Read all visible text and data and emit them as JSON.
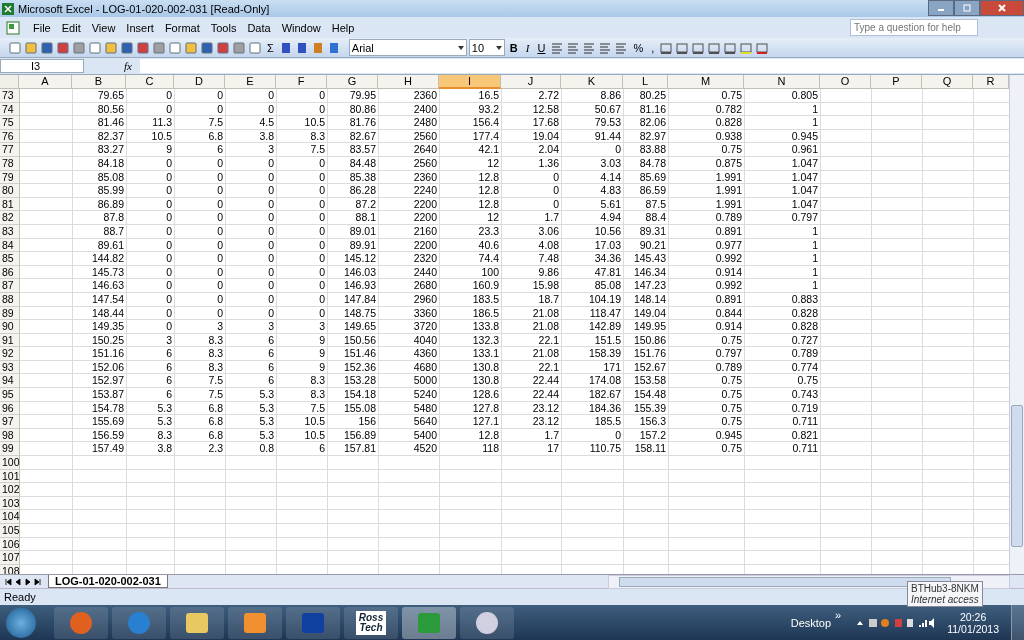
{
  "window": {
    "title": "Microsoft Excel - LOG-01-020-002-031  [Read-Only]"
  },
  "menu": [
    "File",
    "Edit",
    "View",
    "Insert",
    "Format",
    "Tools",
    "Data",
    "Window",
    "Help"
  ],
  "help_box": {
    "placeholder": "Type a question for help"
  },
  "toolbar": {
    "sum": "Σ",
    "font": "Arial",
    "size": "10",
    "format_buttons": [
      "B",
      "I",
      "U"
    ],
    "percent": "%",
    "comma": ","
  },
  "formula_bar": {
    "name_box": "I3",
    "fx": "fx"
  },
  "columns": [
    {
      "label": "A",
      "selected": false
    },
    {
      "label": "B",
      "selected": false
    },
    {
      "label": "C",
      "selected": false
    },
    {
      "label": "D",
      "selected": false
    },
    {
      "label": "E",
      "selected": false
    },
    {
      "label": "F",
      "selected": false
    },
    {
      "label": "G",
      "selected": false
    },
    {
      "label": "H",
      "selected": false
    },
    {
      "label": "I",
      "selected": true
    },
    {
      "label": "J",
      "selected": false
    },
    {
      "label": "K",
      "selected": false
    },
    {
      "label": "L",
      "selected": false
    },
    {
      "label": "M",
      "selected": false
    },
    {
      "label": "N",
      "selected": false
    },
    {
      "label": "O",
      "selected": false
    },
    {
      "label": "P",
      "selected": false
    },
    {
      "label": "Q",
      "selected": false
    },
    {
      "label": "R",
      "selected": false
    }
  ],
  "rows": [
    {
      "num": "73",
      "cells": [
        "79.65",
        "0",
        "0",
        "0",
        "0",
        "79.95",
        "2360",
        "16.5",
        "2.72",
        "8.86",
        "80.25",
        "0.75",
        "0.805"
      ]
    },
    {
      "num": "74",
      "cells": [
        "80.56",
        "0",
        "0",
        "0",
        "0",
        "80.86",
        "2400",
        "93.2",
        "12.58",
        "50.67",
        "81.16",
        "0.782",
        "1"
      ]
    },
    {
      "num": "75",
      "cells": [
        "81.46",
        "11.3",
        "7.5",
        "4.5",
        "10.5",
        "81.76",
        "2480",
        "156.4",
        "17.68",
        "79.53",
        "82.06",
        "0.828",
        "1"
      ]
    },
    {
      "num": "76",
      "cells": [
        "82.37",
        "10.5",
        "6.8",
        "3.8",
        "8.3",
        "82.67",
        "2560",
        "177.4",
        "19.04",
        "91.44",
        "82.97",
        "0.938",
        "0.945"
      ]
    },
    {
      "num": "77",
      "cells": [
        "83.27",
        "9",
        "6",
        "3",
        "7.5",
        "83.57",
        "2640",
        "42.1",
        "2.04",
        "0",
        "83.88",
        "0.75",
        "0.961"
      ]
    },
    {
      "num": "78",
      "cells": [
        "84.18",
        "0",
        "0",
        "0",
        "0",
        "84.48",
        "2560",
        "12",
        "1.36",
        "3.03",
        "84.78",
        "0.875",
        "1.047"
      ]
    },
    {
      "num": "79",
      "cells": [
        "85.08",
        "0",
        "0",
        "0",
        "0",
        "85.38",
        "2360",
        "12.8",
        "0",
        "4.14",
        "85.69",
        "1.991",
        "1.047"
      ]
    },
    {
      "num": "80",
      "cells": [
        "85.99",
        "0",
        "0",
        "0",
        "0",
        "86.28",
        "2240",
        "12.8",
        "0",
        "4.83",
        "86.59",
        "1.991",
        "1.047"
      ]
    },
    {
      "num": "81",
      "cells": [
        "86.89",
        "0",
        "0",
        "0",
        "0",
        "87.2",
        "2200",
        "12.8",
        "0",
        "5.61",
        "87.5",
        "1.991",
        "1.047"
      ]
    },
    {
      "num": "82",
      "cells": [
        "87.8",
        "0",
        "0",
        "0",
        "0",
        "88.1",
        "2200",
        "12",
        "1.7",
        "4.94",
        "88.4",
        "0.789",
        "0.797"
      ]
    },
    {
      "num": "83",
      "cells": [
        "88.7",
        "0",
        "0",
        "0",
        "0",
        "89.01",
        "2160",
        "23.3",
        "3.06",
        "10.56",
        "89.31",
        "0.891",
        "1"
      ]
    },
    {
      "num": "84",
      "cells": [
        "89.61",
        "0",
        "0",
        "0",
        "0",
        "89.91",
        "2200",
        "40.6",
        "4.08",
        "17.03",
        "90.21",
        "0.977",
        "1"
      ]
    },
    {
      "num": "85",
      "cells": [
        "144.82",
        "0",
        "0",
        "0",
        "0",
        "145.12",
        "2320",
        "74.4",
        "7.48",
        "34.36",
        "145.43",
        "0.992",
        "1"
      ]
    },
    {
      "num": "86",
      "cells": [
        "145.73",
        "0",
        "0",
        "0",
        "0",
        "146.03",
        "2440",
        "100",
        "9.86",
        "47.81",
        "146.34",
        "0.914",
        "1"
      ]
    },
    {
      "num": "87",
      "cells": [
        "146.63",
        "0",
        "0",
        "0",
        "0",
        "146.93",
        "2680",
        "160.9",
        "15.98",
        "85.08",
        "147.23",
        "0.992",
        "1"
      ]
    },
    {
      "num": "88",
      "cells": [
        "147.54",
        "0",
        "0",
        "0",
        "0",
        "147.84",
        "2960",
        "183.5",
        "18.7",
        "104.19",
        "148.14",
        "0.891",
        "0.883"
      ]
    },
    {
      "num": "89",
      "cells": [
        "148.44",
        "0",
        "0",
        "0",
        "0",
        "148.75",
        "3360",
        "186.5",
        "21.08",
        "118.47",
        "149.04",
        "0.844",
        "0.828"
      ]
    },
    {
      "num": "90",
      "cells": [
        "149.35",
        "0",
        "3",
        "3",
        "3",
        "149.65",
        "3720",
        "133.8",
        "21.08",
        "142.89",
        "149.95",
        "0.914",
        "0.828"
      ]
    },
    {
      "num": "91",
      "cells": [
        "150.25",
        "3",
        "8.3",
        "6",
        "9",
        "150.56",
        "4040",
        "132.3",
        "22.1",
        "151.5",
        "150.86",
        "0.75",
        "0.727"
      ]
    },
    {
      "num": "92",
      "cells": [
        "151.16",
        "6",
        "8.3",
        "6",
        "9",
        "151.46",
        "4360",
        "133.1",
        "21.08",
        "158.39",
        "151.76",
        "0.797",
        "0.789"
      ]
    },
    {
      "num": "93",
      "cells": [
        "152.06",
        "6",
        "8.3",
        "6",
        "9",
        "152.36",
        "4680",
        "130.8",
        "22.1",
        "171",
        "152.67",
        "0.789",
        "0.774"
      ]
    },
    {
      "num": "94",
      "cells": [
        "152.97",
        "6",
        "7.5",
        "6",
        "8.3",
        "153.28",
        "5000",
        "130.8",
        "22.44",
        "174.08",
        "153.58",
        "0.75",
        "0.75"
      ]
    },
    {
      "num": "95",
      "cells": [
        "153.87",
        "6",
        "7.5",
        "5.3",
        "8.3",
        "154.18",
        "5240",
        "128.6",
        "22.44",
        "182.67",
        "154.48",
        "0.75",
        "0.743"
      ]
    },
    {
      "num": "96",
      "cells": [
        "154.78",
        "5.3",
        "6.8",
        "5.3",
        "7.5",
        "155.08",
        "5480",
        "127.8",
        "23.12",
        "184.36",
        "155.39",
        "0.75",
        "0.719"
      ]
    },
    {
      "num": "97",
      "cells": [
        "155.69",
        "5.3",
        "6.8",
        "5.3",
        "10.5",
        "156",
        "5640",
        "127.1",
        "23.12",
        "185.5",
        "156.3",
        "0.75",
        "0.711"
      ]
    },
    {
      "num": "98",
      "cells": [
        "156.59",
        "8.3",
        "6.8",
        "5.3",
        "10.5",
        "156.89",
        "5400",
        "12.8",
        "1.7",
        "0",
        "157.2",
        "0.945",
        "0.821"
      ]
    },
    {
      "num": "99",
      "cells": [
        "157.49",
        "3.8",
        "2.3",
        "0.8",
        "6",
        "157.81",
        "4520",
        "118",
        "17",
        "110.75",
        "158.11",
        "0.75",
        "0.711"
      ]
    },
    {
      "num": "100"
    },
    {
      "num": "101"
    },
    {
      "num": "102"
    },
    {
      "num": "103"
    },
    {
      "num": "104"
    },
    {
      "num": "105"
    },
    {
      "num": "106"
    },
    {
      "num": "107"
    },
    {
      "num": "108"
    }
  ],
  "sheet_tabs": [
    {
      "label": "LOG-01-020-002-031",
      "selected": true
    }
  ],
  "status_bar": {
    "text": "Ready"
  },
  "taskbar": {
    "pinned_label": "Ross Tech",
    "desktop": "Desktop",
    "chevron": "»",
    "time": "20:26",
    "date": "11/01/2013"
  },
  "tooltip": {
    "title": "BTHub3-8NKM",
    "subtitle": "Internet access"
  }
}
